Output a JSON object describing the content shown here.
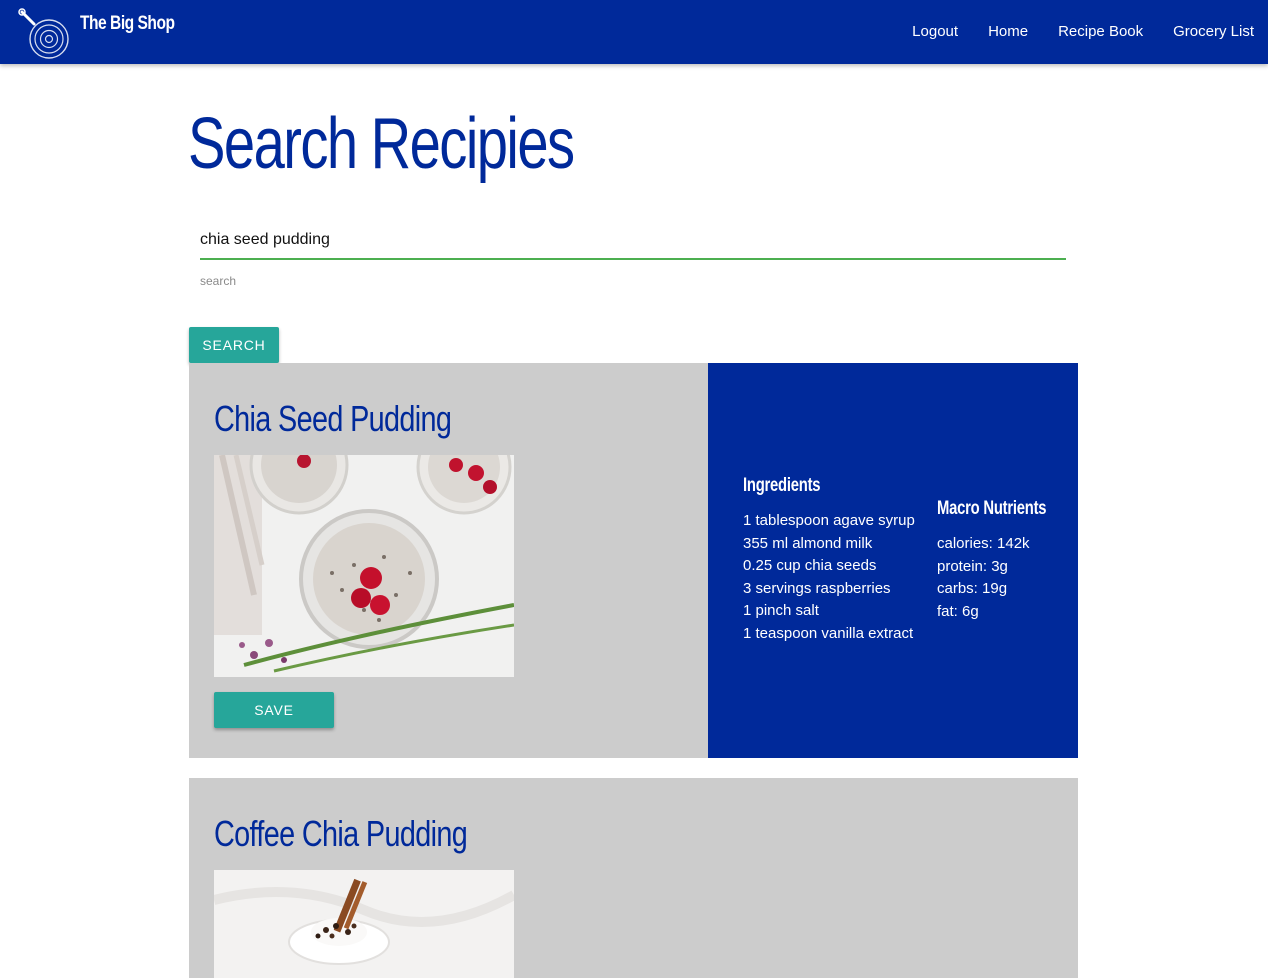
{
  "app": {
    "brand": "The Big Shop",
    "nav": [
      {
        "label": "Logout"
      },
      {
        "label": "Home"
      },
      {
        "label": "Recipe Book"
      },
      {
        "label": "Grocery List"
      }
    ]
  },
  "page": {
    "title": "Search Recipies"
  },
  "search": {
    "value": "chia seed pudding",
    "helper": "search",
    "button_label": "SEARCH"
  },
  "results": [
    {
      "title": "Chia Seed Pudding",
      "save_label": "SAVE",
      "ingredients_heading": "Ingredients",
      "ingredients": [
        "1 tablespoon agave syrup",
        "355 ml almond milk",
        "0.25 cup chia seeds",
        "3 servings raspberries",
        "1 pinch salt",
        "1 teaspoon vanilla extract"
      ],
      "macros_heading": "Macro Nutrients",
      "macros": [
        "calories: 142k",
        "protein: 3g",
        "carbs: 19g",
        "fat: 6g"
      ]
    },
    {
      "title": "Coffee Chia Pudding"
    }
  ],
  "colors": {
    "primary": "#00299a",
    "accent": "#26a69a",
    "card_bg": "#cccccc",
    "input_underline": "#4caf50"
  }
}
